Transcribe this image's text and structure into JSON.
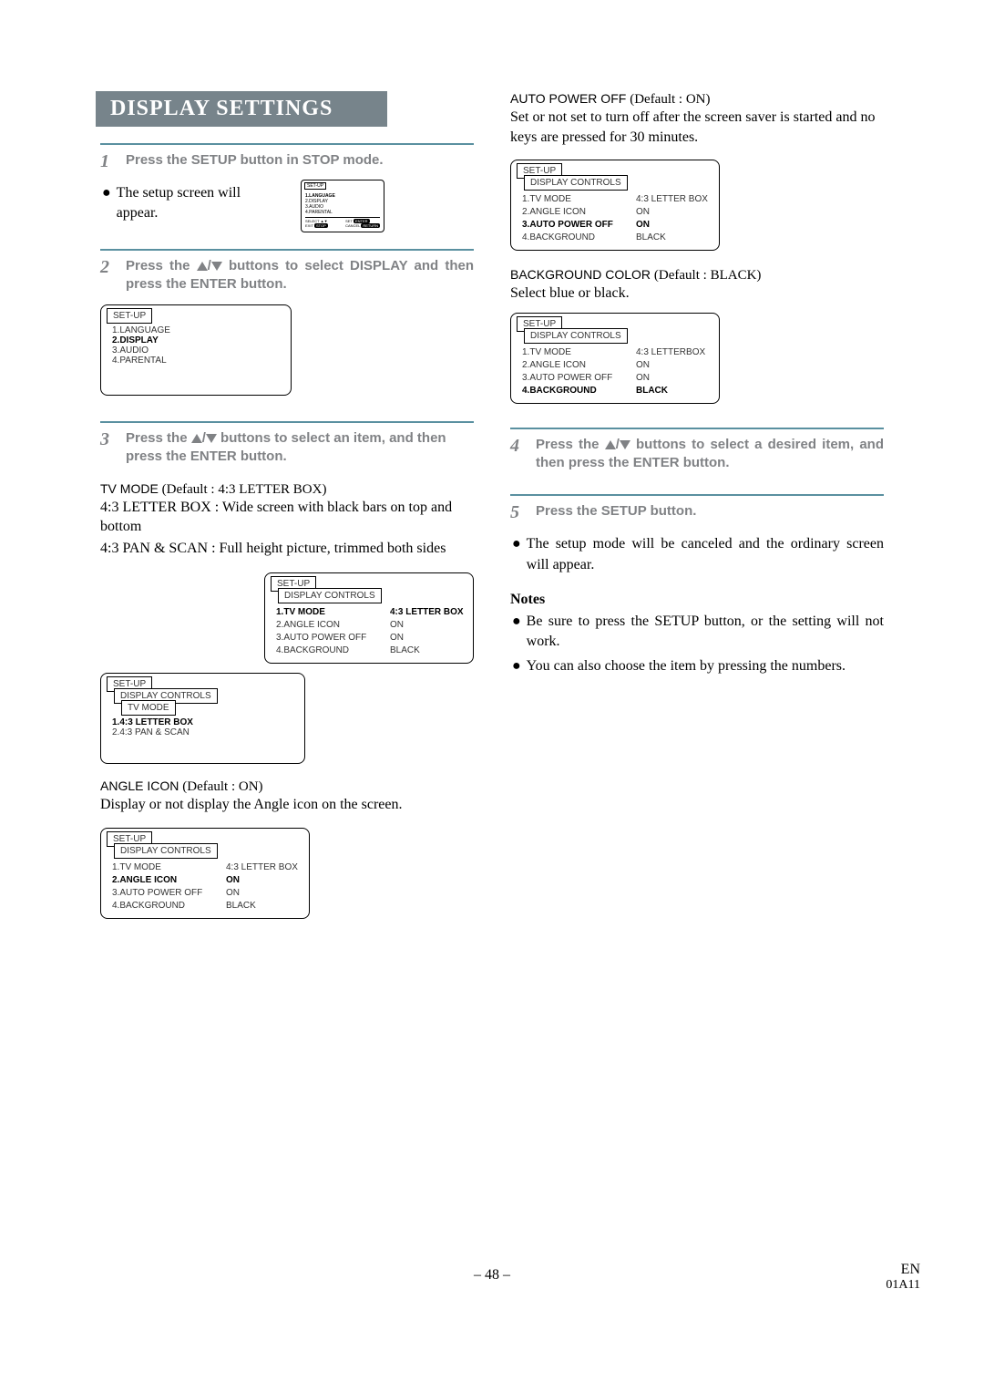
{
  "heading": "DISPLAY SETTINGS",
  "col1": {
    "step1": {
      "num": "1",
      "text": "Press the SETUP button in STOP mode.",
      "bullet": "The setup screen will appear."
    },
    "step2": {
      "num": "2",
      "text_a": "Press the ",
      "text_b": " buttons to select DISPLAY and then press the ENTER button."
    },
    "step3": {
      "num": "3",
      "text_a": "Press the ",
      "text_b": " buttons to select an item, and then press the ENTER button."
    },
    "tvmode": {
      "label": "TV MODE",
      "default": "(Default : 4:3 LETTER BOX)",
      "l1": "4:3 LETTER BOX : Wide screen with black bars on top and bottom",
      "l2": "4:3 PAN & SCAN : Full height picture, trimmed both sides"
    },
    "angle": {
      "label": "ANGLE ICON",
      "default": "(Default : ON)",
      "l1": "Display or not display the Angle icon on the screen."
    }
  },
  "col2": {
    "autopower": {
      "label": "AUTO POWER OFF",
      "default": "(Default : ON)",
      "l1": "Set or not set to turn off after the screen saver is started and no keys are pressed for 30 minutes."
    },
    "bg": {
      "label": "BACKGROUND COLOR",
      "default": "(Default : BLACK)",
      "l1": "Select blue or black."
    },
    "step4": {
      "num": "4",
      "text_a": "Press the ",
      "text_b": " buttons to select a desired item, and then press the ENTER button."
    },
    "step5": {
      "num": "5",
      "text": "Press the SETUP button.",
      "bullet": "The setup mode will be canceled and the ordinary screen will appear."
    },
    "notes": {
      "h": "Notes",
      "n1": "Be sure to press the SETUP button, or the setting will not work.",
      "n2": "You can also choose the item by pressing the numbers."
    }
  },
  "osd": {
    "setup_tab": "SET-UP",
    "display_tab": "DISPLAY CONTROLS",
    "tvmode_tab": "TV MODE",
    "main_menu": {
      "i1": "1.LANGUAGE",
      "i2": "2.DISPLAY",
      "i3": "3.AUDIO",
      "i4": "4.PARENTAL"
    },
    "disp_menu": {
      "r1k": "1.TV MODE",
      "r1v": "4:3 LETTER BOX",
      "r2k": "2.ANGLE ICON",
      "r2v": "ON",
      "r3k": "3.AUTO POWER OFF",
      "r3v": "ON",
      "r4k": "4.BACKGROUND",
      "r4v": "BLACK"
    },
    "disp_menu_apo": {
      "r1k": "1.TV MODE",
      "r1v": "4:3 LETTER BOX",
      "r2k": "2.ANGLE ICON",
      "r2v": "ON",
      "r3k": "3.AUTO POWER OFF",
      "r3v": "ON",
      "r4k": "4.BACKGROUND",
      "r4v": "BLACK"
    },
    "disp_menu_bg": {
      "r1k": "1.TV MODE",
      "r1v": "4:3 LETTERBOX",
      "r2k": "2.ANGLE ICON",
      "r2v": "ON",
      "r3k": "3.AUTO POWER OFF",
      "r3v": "ON",
      "r4k": "4.BACKGROUND",
      "r4v": "BLACK"
    },
    "tvmode_menu": {
      "i1": "1.4:3 LETTER BOX",
      "i2": "2.4:3 PAN & SCAN"
    },
    "tiny": {
      "i1": "1.LANGUAGE",
      "i2": "2.DISPLAY",
      "i3": "3.AUDIO",
      "i4": "4.PARENTAL",
      "sel": "SELECT",
      "exit": "EXIT",
      "set": "SET",
      "cancel": "CANCEL",
      "enter": "ENTER",
      "return": "RETURN",
      "stop": "STOP"
    }
  },
  "footer": {
    "page": "– 48 –",
    "lang": "EN",
    "code": "01A11"
  }
}
